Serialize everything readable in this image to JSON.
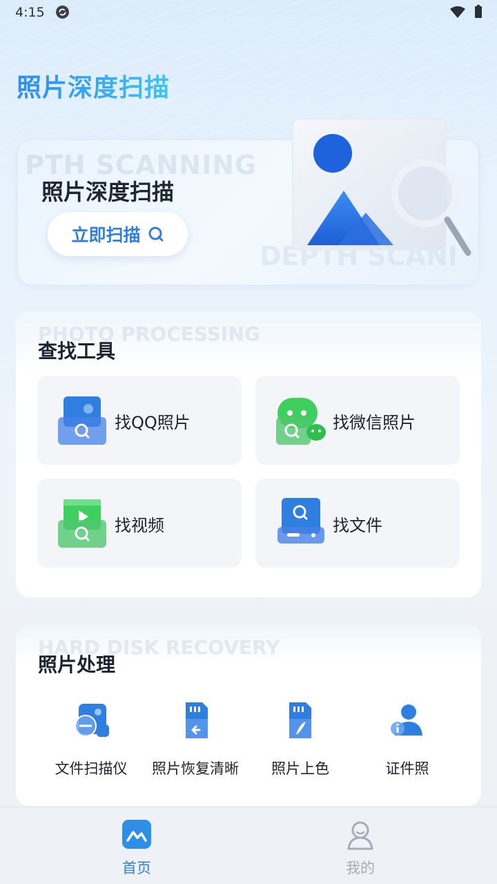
{
  "status_bar": {
    "time": "4:15",
    "icons": [
      "sync-icon",
      "wifi-icon",
      "battery-icon"
    ]
  },
  "app": {
    "title": "照片深度扫描"
  },
  "banner": {
    "title": "照片深度扫描",
    "watermark_top": "PTH SCANNING",
    "watermark_bottom": "DEPTH SCANI",
    "button_label": "立即扫描",
    "button_icon": "search-icon"
  },
  "find_tools": {
    "watermark": "PHOTO PROCESSING",
    "title": "查找工具",
    "items": [
      {
        "label": "找QQ照片",
        "icon": "qq-photo-icon"
      },
      {
        "label": "找微信照片",
        "icon": "wechat-photo-icon"
      },
      {
        "label": "找视频",
        "icon": "video-icon"
      },
      {
        "label": "找文件",
        "icon": "file-icon"
      }
    ]
  },
  "photo_processing": {
    "watermark": "HARD DISK RECOVERY",
    "title": "照片处理",
    "items": [
      {
        "label": "文件扫描仪",
        "icon": "document-scanner-icon"
      },
      {
        "label": "照片恢复清晰",
        "icon": "photo-restore-icon"
      },
      {
        "label": "照片上色",
        "icon": "photo-colorize-icon"
      },
      {
        "label": "证件照",
        "icon": "id-photo-icon"
      }
    ]
  },
  "bottom_nav": {
    "items": [
      {
        "label": "首页",
        "icon": "home-icon",
        "active": true
      },
      {
        "label": "我的",
        "icon": "profile-icon",
        "active": false
      }
    ]
  },
  "colors": {
    "accent": "#2f7fe0",
    "title_gradient_start": "#2d8cf0",
    "title_gradient_end": "#3fc3f6",
    "active_nav": "#2f7fe0",
    "inactive_nav": "#a7acb6"
  }
}
